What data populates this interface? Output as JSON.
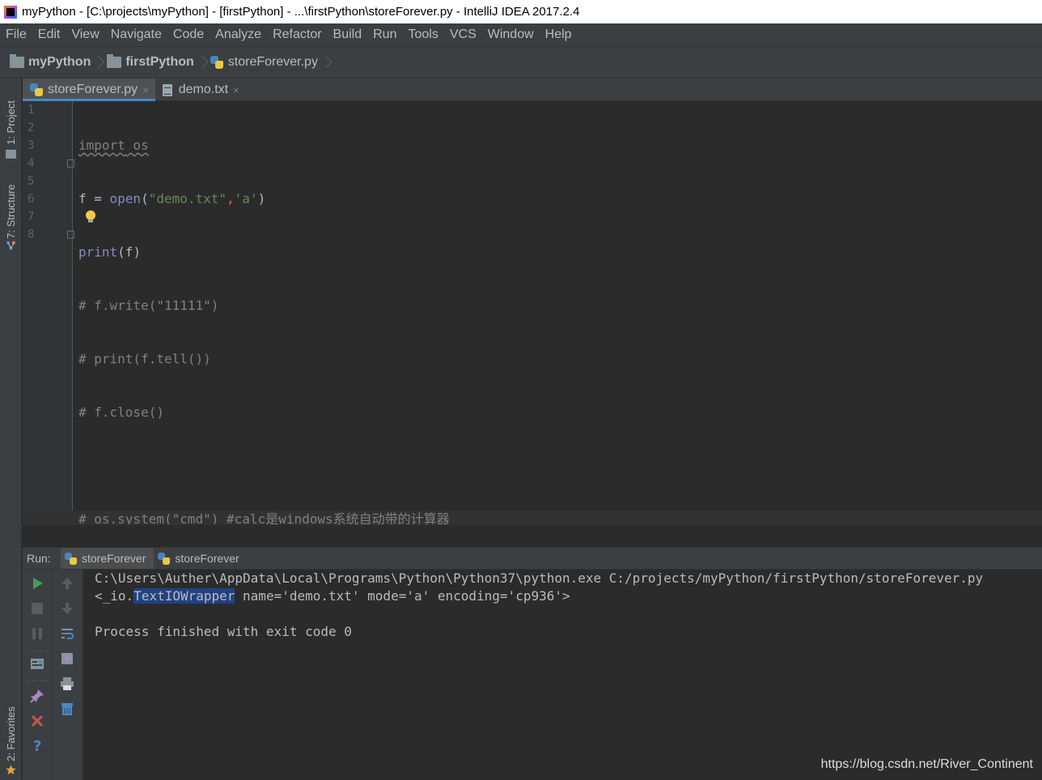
{
  "window": {
    "title": "myPython - [C:\\projects\\myPython] - [firstPython] - ...\\firstPython\\storeForever.py - IntelliJ IDEA 2017.2.4"
  },
  "menu": [
    "File",
    "Edit",
    "View",
    "Navigate",
    "Code",
    "Analyze",
    "Refactor",
    "Build",
    "Run",
    "Tools",
    "VCS",
    "Window",
    "Help"
  ],
  "breadcrumbs": [
    "myPython",
    "firstPython",
    "storeForever.py"
  ],
  "tool_windows": {
    "project": "1: Project",
    "structure": "7: Structure",
    "favorites": "2: Favorites"
  },
  "editor_tabs": [
    {
      "label": "storeForever.py",
      "close": "×",
      "active": true
    },
    {
      "label": "demo.txt",
      "close": "×",
      "active": false
    }
  ],
  "line_numbers": [
    "1",
    "2",
    "3",
    "4",
    "5",
    "6",
    "7",
    "8"
  ],
  "code": {
    "l1_kw": "import",
    "l1_mod": " os",
    "l2_a": "f = ",
    "l2_fn": "open",
    "l2_b": "(",
    "l2_s1": "\"demo.txt\"",
    "l2_c": ",",
    "l2_s2": "'a'",
    "l2_d": ")",
    "l3_fn": "print",
    "l3_b": "(f)",
    "l4": "# f.write(\"11111\")",
    "l5": "# print(f.tell())",
    "l6": "# f.close()",
    "l8": "# os.system(\"cmd\") #calc是windows系统自动带的计算器"
  },
  "run": {
    "label": "Run:",
    "tabs": [
      "storeForever",
      "storeForever"
    ],
    "console": {
      "line1": "C:\\Users\\Auther\\AppData\\Local\\Programs\\Python\\Python37\\python.exe C:/projects/myPython/firstPython/storeForever.py",
      "line2_a": "<_io.",
      "line2_sel": "TextIOWrapper",
      "line2_b": " name='demo.txt' mode='a' encoding='cp936'>",
      "line4": "Process finished with exit code 0"
    }
  },
  "watermark": "https://blog.csdn.net/River_Continent"
}
